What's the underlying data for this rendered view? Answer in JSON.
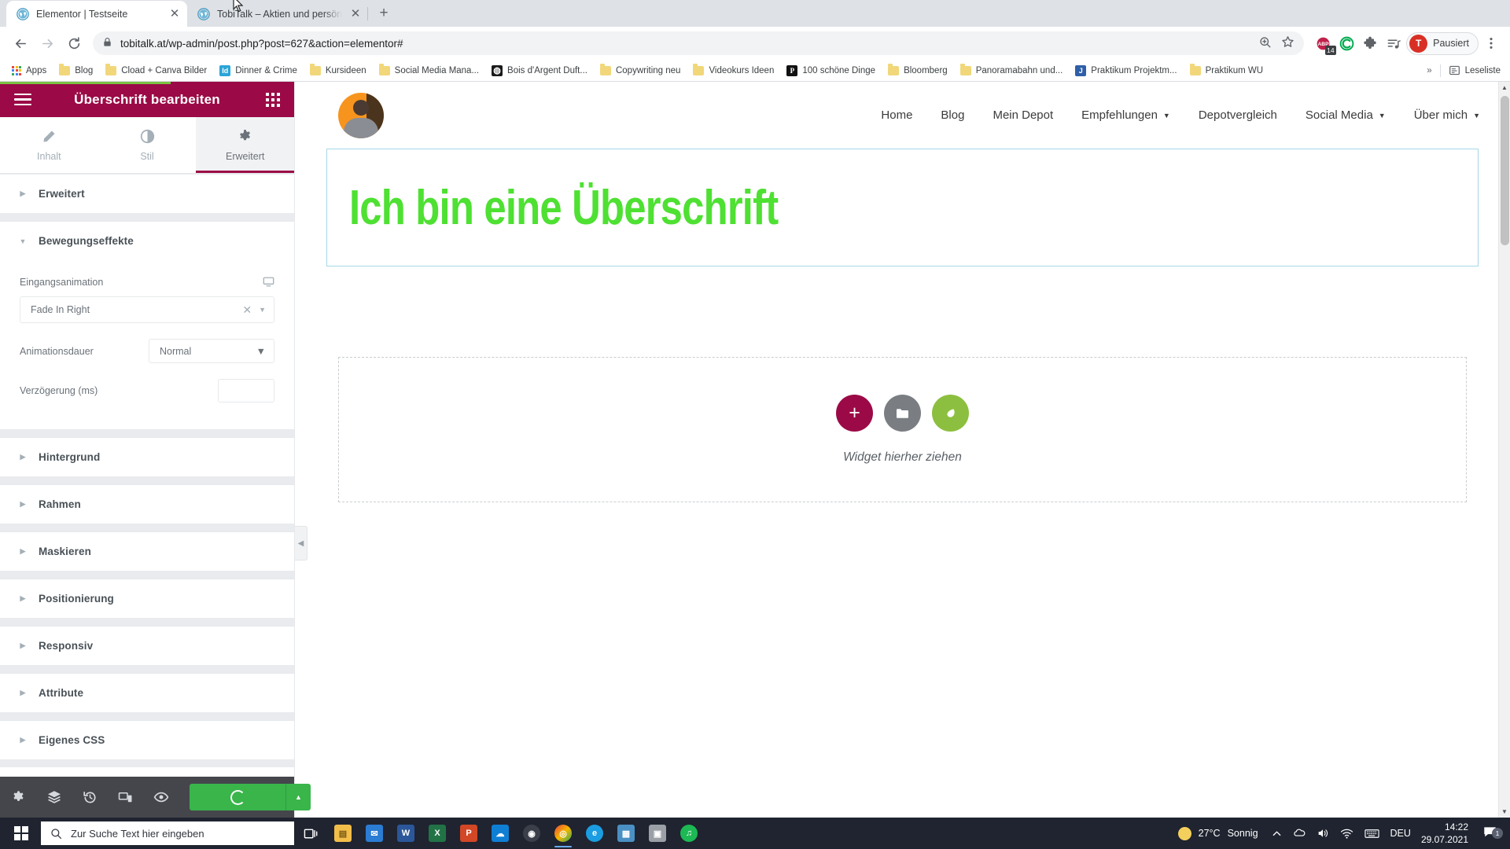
{
  "browser": {
    "tabs": [
      {
        "title": "Elementor | Testseite",
        "active": true,
        "favicon": "wordpress-icon"
      },
      {
        "title": "TobiTalk – Aktien und persönlich...",
        "active": false,
        "favicon": "wordpress-icon"
      }
    ],
    "new_tab_label": "+",
    "nav": {
      "back": "←",
      "forward": "→",
      "reload": "⟳"
    },
    "omnibox": {
      "url": "tobitalk.at/wp-admin/post.php?post=627&action=elementor#",
      "lock_icon": "lock-icon",
      "zoom_icon": "zoom-icon",
      "star_icon": "star-icon"
    },
    "extensions": [
      {
        "name": "adblock-icon",
        "label": "ABP",
        "badge": "14",
        "color": "#c0224b"
      },
      {
        "name": "ghostery-icon",
        "label": "C",
        "color": "#00a94f"
      },
      {
        "name": "puzzle-icon",
        "label": "",
        "color": "#5f6368"
      },
      {
        "name": "playlist-icon",
        "label": "",
        "color": "#5f6368"
      }
    ],
    "profile": {
      "initial": "T",
      "label": "Pausiert"
    },
    "menu_icon": "three-dots-menu-icon",
    "bookmarks": [
      {
        "label": "Apps",
        "icon": "apps-grid-icon"
      },
      {
        "label": "Blog",
        "icon": "folder-icon"
      },
      {
        "label": "Cload + Canva Bilder",
        "icon": "folder-icon"
      },
      {
        "label": "Dinner & Crime",
        "icon": "indesign-icon",
        "color": "#2ba5d8",
        "glyph": "Id"
      },
      {
        "label": "Kursideen",
        "icon": "folder-icon"
      },
      {
        "label": "Social Media Mana...",
        "icon": "folder-icon"
      },
      {
        "label": "Bois d'Argent Duft...",
        "icon": "site-icon",
        "color": "#1a1a1a",
        "glyph": "◍"
      },
      {
        "label": "Copywriting neu",
        "icon": "folder-icon"
      },
      {
        "label": "Videokurs Ideen",
        "icon": "folder-icon"
      },
      {
        "label": "100 schöne Dinge",
        "icon": "site-icon",
        "color": "#1a1a1a",
        "glyph": "P"
      },
      {
        "label": "Bloomberg",
        "icon": "folder-icon"
      },
      {
        "label": "Panoramabahn und...",
        "icon": "folder-icon"
      },
      {
        "label": "Praktikum Projektm...",
        "icon": "indesign-icon",
        "color": "#2f5fa8",
        "glyph": "J"
      },
      {
        "label": "Praktikum WU",
        "icon": "folder-icon"
      }
    ],
    "overflow_label": "»",
    "reading_list": {
      "label": "Leseliste",
      "icon": "reading-list-icon"
    }
  },
  "elementor": {
    "topbar": {
      "title": "Überschrift bearbeiten",
      "menu_icon": "hamburger-icon",
      "grid_icon": "widgets-grid-icon"
    },
    "tabs": [
      {
        "label": "Inhalt",
        "icon": "pencil-icon",
        "active": false
      },
      {
        "label": "Stil",
        "icon": "contrast-icon",
        "active": false
      },
      {
        "label": "Erweitert",
        "icon": "gear-icon",
        "active": true
      }
    ],
    "sections": [
      {
        "label": "Erweitert",
        "open": false
      },
      {
        "label": "Bewegungseffekte",
        "open": true
      },
      {
        "label": "Hintergrund",
        "open": false
      },
      {
        "label": "Rahmen",
        "open": false
      },
      {
        "label": "Maskieren",
        "open": false
      },
      {
        "label": "Positionierung",
        "open": false
      },
      {
        "label": "Responsiv",
        "open": false
      },
      {
        "label": "Attribute",
        "open": false
      },
      {
        "label": "Eigenes CSS",
        "open": false
      }
    ],
    "motion": {
      "entrance_label": "Eingangsanimation",
      "entrance_value": "Fade In Right",
      "responsive_icon": "desktop-icon",
      "clear_icon": "clear-x-icon",
      "duration_label": "Animationsdauer",
      "duration_value": "Normal",
      "delay_label": "Verzögerung (ms)",
      "delay_value": ""
    },
    "footer": {
      "icons": [
        "gear-icon",
        "navigator-layers-icon",
        "history-icon",
        "responsive-mode-icon",
        "preview-eye-icon"
      ],
      "publish_icon": "loading-spinner-icon",
      "publish_options_icon": "chevron-up-icon"
    },
    "collapse_handle_icon": "chevron-left-icon"
  },
  "site": {
    "logo_alt": "avatar-logo",
    "nav": [
      {
        "label": "Home",
        "dropdown": false
      },
      {
        "label": "Blog",
        "dropdown": false
      },
      {
        "label": "Mein Depot",
        "dropdown": false
      },
      {
        "label": "Empfehlungen",
        "dropdown": true
      },
      {
        "label": "Depotvergleich",
        "dropdown": false
      },
      {
        "label": "Social Media",
        "dropdown": true
      },
      {
        "label": "Über mich",
        "dropdown": true
      }
    ],
    "heading": "Ich bin eine Überschrift",
    "heading_color": "#4ee032",
    "dropzone": {
      "text": "Widget hierher ziehen",
      "add_icon": "plus-icon",
      "folder_icon": "folder-template-icon",
      "leaf_icon": "elementor-leaf-icon"
    }
  },
  "taskbar": {
    "start_icon": "windows-start-icon",
    "search_placeholder": "Zur Suche Text hier eingeben",
    "search_icon": "search-icon",
    "taskview_icon": "task-view-icon",
    "apps": [
      {
        "name": "file-explorer",
        "glyph": "▤",
        "color": "#f3bd4a",
        "running": false
      },
      {
        "name": "mail",
        "glyph": "✉",
        "color": "#2b7cd3",
        "running": false
      },
      {
        "name": "word",
        "glyph": "W",
        "color": "#2b579a",
        "running": false
      },
      {
        "name": "excel",
        "glyph": "X",
        "color": "#217346",
        "running": false
      },
      {
        "name": "powerpoint",
        "glyph": "P",
        "color": "#d24726",
        "running": false
      },
      {
        "name": "onedrive",
        "glyph": "☁",
        "color": "#0f7fd4",
        "running": false
      },
      {
        "name": "obs-studio",
        "glyph": "◉",
        "color": "#3a3f4a",
        "running": false
      },
      {
        "name": "chrome",
        "glyph": "◎",
        "color": "#e8453c",
        "running": true
      },
      {
        "name": "edge",
        "glyph": "e",
        "color": "#1b9de2",
        "running": false
      },
      {
        "name": "photoshop-lightroom",
        "glyph": "▦",
        "color": "#4a90c4",
        "running": false
      },
      {
        "name": "photos",
        "glyph": "▣",
        "color": "#9aa0a6",
        "running": false
      },
      {
        "name": "spotify",
        "glyph": "♫",
        "color": "#1db954",
        "running": false
      }
    ],
    "tray": {
      "weather_temp": "27°C",
      "weather_desc": "Sonnig",
      "weather_icon": "sun-icon",
      "chevron_icon": "show-hidden-icons-chevron",
      "onedrive_icon": "onedrive-tray-icon",
      "volume_icon": "volume-icon",
      "network_icon": "wifi-icon",
      "keyboard_icon": "touch-keyboard-icon",
      "language": "DEU",
      "time": "14:22",
      "date": "29.07.2021",
      "notifications_icon": "notification-icon",
      "notifications_count": "1"
    }
  }
}
